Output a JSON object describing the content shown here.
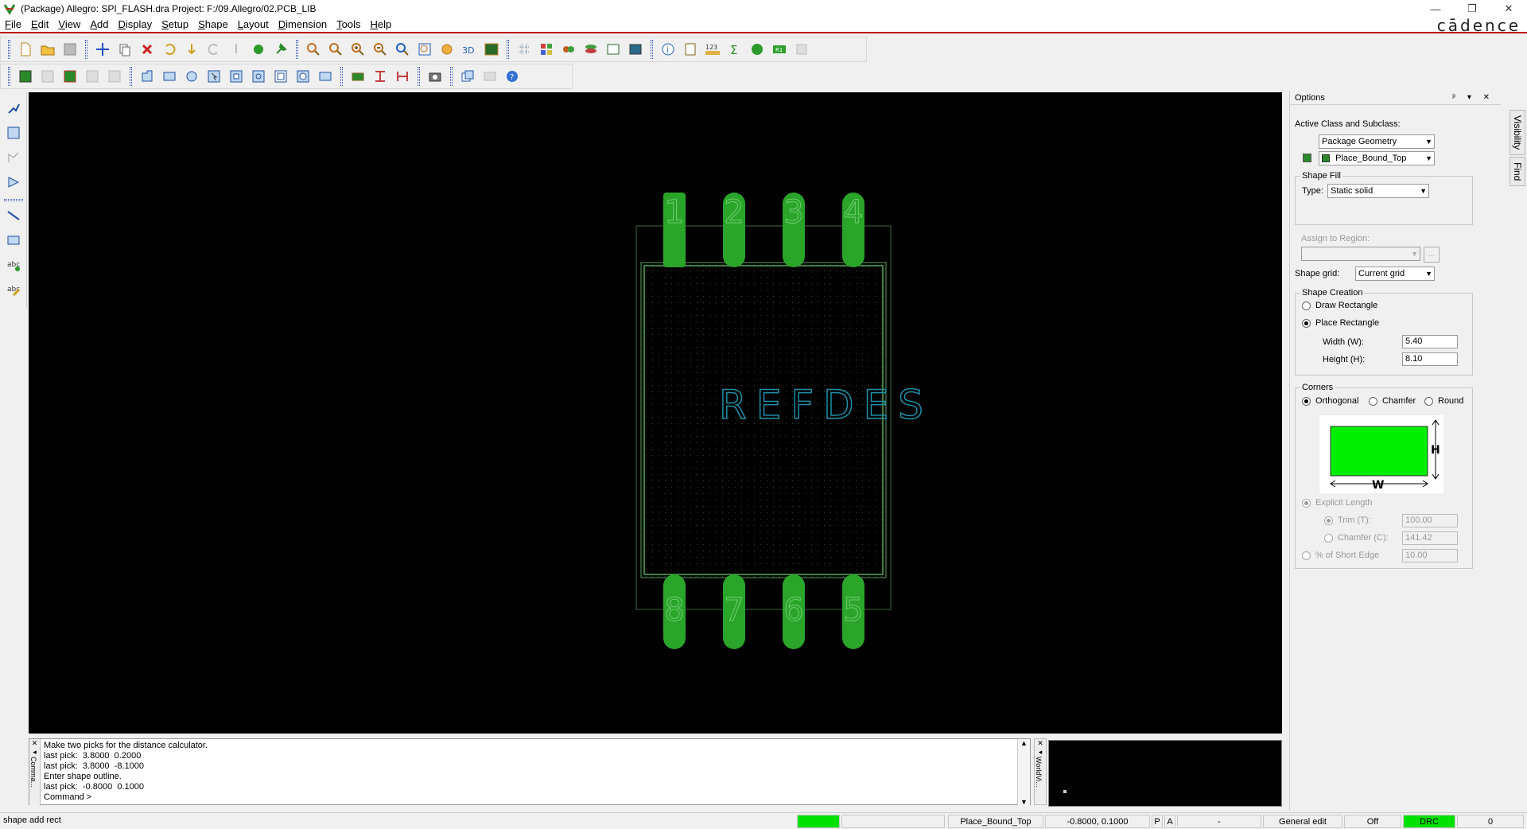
{
  "window": {
    "title": "(Package) Allegro: SPI_FLASH.dra  Project: F:/09.Allegro/02.PCB_LIB",
    "minimize": "—",
    "restore": "❐",
    "close": "✕",
    "brand": "cādence"
  },
  "menu": [
    "File",
    "Edit",
    "View",
    "Add",
    "Display",
    "Setup",
    "Shape",
    "Layout",
    "Dimension",
    "Tools",
    "Help"
  ],
  "canvas": {
    "pins_top": [
      "1",
      "2",
      "3",
      "4"
    ],
    "pins_bottom": [
      "8",
      "7",
      "6",
      "5"
    ],
    "refdes": "REFDES",
    "pin_color": "#2aa52a",
    "outline_color": "#4a9a4a",
    "refdes_color": "#1f8fa8"
  },
  "options": {
    "header": "Options",
    "header_controls": "ᵖ ▾ ✕",
    "active_class_label": "Active Class and Subclass:",
    "class_value": "Package Geometry",
    "subclass_value": "Place_Bound_Top",
    "subclass_color": "#2a8a2a",
    "shape_fill_title": "Shape Fill",
    "type_label": "Type:",
    "type_value": "Static solid",
    "assign_region_label": "Assign to Region:",
    "assign_region_button": "...",
    "shape_grid_label": "Shape grid:",
    "shape_grid_value": "Current grid",
    "shape_creation_title": "Shape Creation",
    "draw_rect": "Draw Rectangle",
    "place_rect": "Place Rectangle",
    "width_label": "Width (W):",
    "width_value": "5.40",
    "height_label": "Height (H):",
    "height_value": "8.10",
    "corners_title": "Corners",
    "orthogonal": "Orthogonal",
    "chamfer": "Chamfer",
    "round": "Round",
    "diagram_h": "H",
    "diagram_w": "W",
    "explicit_length": "Explicit Length",
    "trim_label": "Trim (T):",
    "trim_value": "100.00",
    "chamfer_c_label": "Chamfer (C):",
    "chamfer_c_value": "141.42",
    "short_edge_label": "% of Short Edge",
    "short_edge_value": "10.00"
  },
  "side_tabs": [
    "Visibility",
    "Find"
  ],
  "command": {
    "strip_label": "Comma...",
    "lines": "Make two picks for the distance calculator.\nlast pick:  3.8000  0.2000\nlast pick:  3.8000  -8.1000\nEnter shape outline.\nlast pick:  -0.8000  0.1000\nCommand >",
    "worldview_label": "WorldVi..."
  },
  "status": {
    "command_name": "shape add rect",
    "subclass": "Place_Bound_Top",
    "coords": "-0.8000, 0.1000",
    "p": "P",
    "a": "A",
    "dash": "-",
    "mode": "General edit",
    "off": "Off",
    "drc": "DRC",
    "count": "0",
    "green": "#00e000"
  }
}
